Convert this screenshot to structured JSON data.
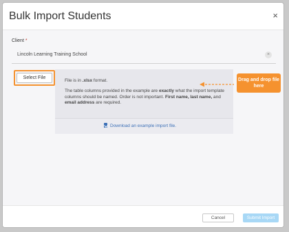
{
  "modal": {
    "title": "Bulk Import Students",
    "close_glyph": "×"
  },
  "client": {
    "label": "Client",
    "required_mark": "*",
    "value": "Lincoln Learning Training School",
    "clear_glyph": "×"
  },
  "select_file": {
    "label": "Select File"
  },
  "drop_zone": {
    "format_prefix": "File is in ",
    "format_value": ".xlsx",
    "format_suffix": " format.",
    "para_part1": "The table columns provided in the example are ",
    "para_bold1": "exactly",
    "para_part2": " what the import template columns should be named. Order is not important. ",
    "para_bold2": "First name, last name,",
    "para_part3": " and ",
    "para_bold3": "email address",
    "para_part4": " are required.",
    "download_label": "Download an example import file."
  },
  "callout": {
    "text": "Drag and drop file here",
    "color": "#f5922f"
  },
  "footer": {
    "cancel_label": "Cancel",
    "submit_label": "Submit Import"
  },
  "colors": {
    "accent": "#f5922f",
    "link": "#3b6fb6",
    "submit_disabled": "#a8d8f6"
  }
}
